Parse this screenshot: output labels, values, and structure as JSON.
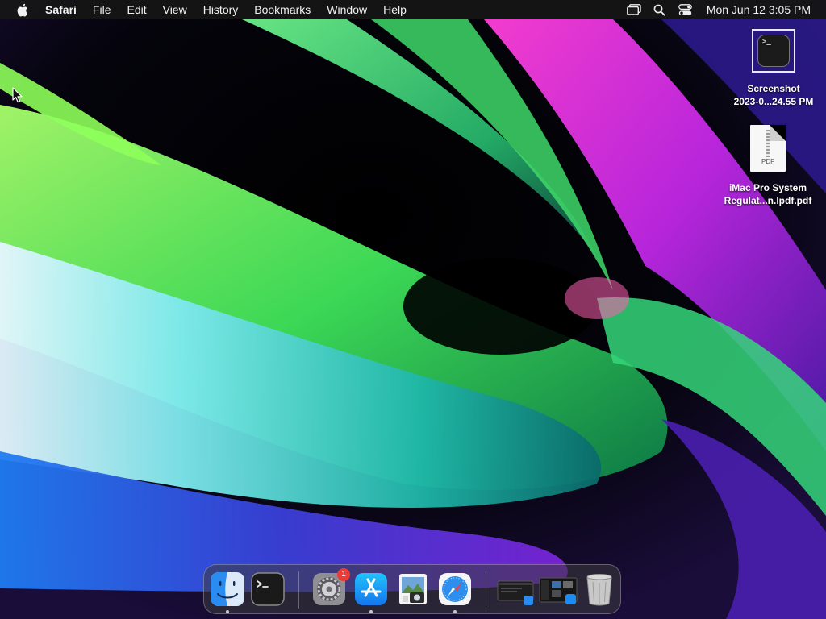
{
  "menubar": {
    "apple_icon": "apple-logo-icon",
    "app_name": "Safari",
    "items": [
      "File",
      "Edit",
      "View",
      "History",
      "Bookmarks",
      "Window",
      "Help"
    ],
    "status_icons": [
      "screen-mirroring-icon",
      "spotlight-search-icon",
      "control-center-icon"
    ],
    "clock": "Mon Jun 12  3:05 PM"
  },
  "desktop": {
    "items": [
      {
        "label_line1": "Screenshot",
        "label_line2": "2023-0...24.55 PM",
        "icon": "terminal-icon"
      },
      {
        "label_line1": "iMac Pro System",
        "label_line2": "Regulat...n.lpdf.pdf",
        "icon": "pdf-document-icon",
        "tag": "PDF"
      }
    ]
  },
  "dock": {
    "apps": [
      {
        "name": "Finder",
        "icon": "finder-icon",
        "running": true
      },
      {
        "name": "Terminal",
        "icon": "terminal-icon",
        "running": false
      },
      {
        "name": "System Settings",
        "icon": "system-settings-icon",
        "running": false,
        "badge": "1"
      },
      {
        "name": "App Store",
        "icon": "app-store-icon",
        "running": true
      },
      {
        "name": "Preview",
        "icon": "preview-icon",
        "running": false
      },
      {
        "name": "Safari",
        "icon": "safari-icon",
        "running": true
      }
    ],
    "recent": [
      {
        "name": "Minimized window 1",
        "icon": "window-thumbnail-icon"
      },
      {
        "name": "Minimized window 2",
        "icon": "window-thumbnail-icon"
      }
    ],
    "trash": {
      "name": "Trash",
      "icon": "trash-icon"
    }
  },
  "colors": {
    "menubar_bg": "#161616",
    "badge": "#ef3b36",
    "wallpaper_green": "#5ee83a",
    "wallpaper_magenta": "#e13cff",
    "wallpaper_cyan": "#3fd8d0",
    "wallpaper_blue": "#1b6ff0"
  }
}
